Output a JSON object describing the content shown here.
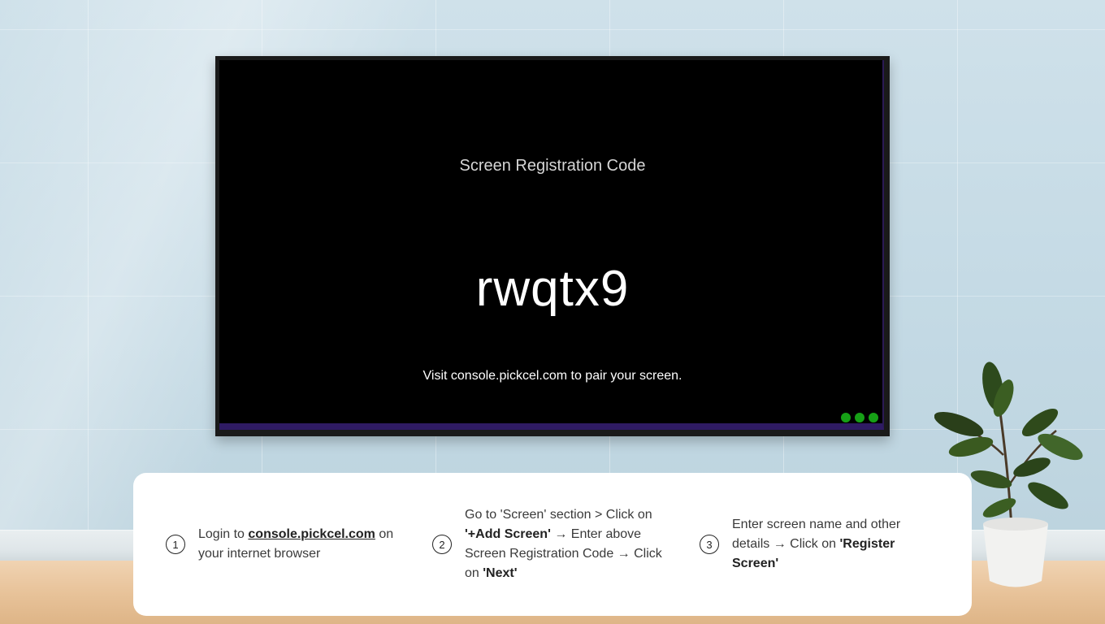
{
  "screen": {
    "title": "Screen Registration Code",
    "code": "rwqtx9",
    "visit_text": "Visit console.pickcel.com to pair your screen."
  },
  "indicator": {
    "color": "#16a016",
    "dots": 3
  },
  "steps": [
    {
      "number": "1",
      "prefix": "Login to ",
      "link": "console.pickcel.com",
      "suffix": " on your internet browser"
    },
    {
      "number": "2",
      "text1": "Go to 'Screen' section > Click on ",
      "bold1": "'+Add Screen'",
      "text2": " → Enter above Screen Registration Code → Click on ",
      "bold2": "'Next'"
    },
    {
      "number": "3",
      "text1": "Enter screen name and other details → Click on ",
      "bold1": "'Register Screen'"
    }
  ]
}
